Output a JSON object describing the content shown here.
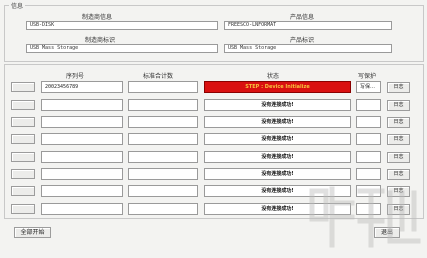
{
  "info": {
    "group_title": "信息",
    "manufacturer_info_label": "制造商信息",
    "product_info_label": "产品信息",
    "manufacturer_id_label": "制造商标识",
    "product_id_label": "产品标识",
    "manufacturer_info_value": "USB-DISK",
    "product_info_value": "FREESCO-LNFORMAT",
    "manufacturer_id_value": "USB Mass Storage",
    "product_id_value": "USB Mass Storage"
  },
  "table": {
    "headers": {
      "serial": "序列号",
      "counter": "标准合计数",
      "status": "状态",
      "protect": "写保护"
    },
    "log_label": "日志",
    "rows": [
      {
        "serial": "20023456789",
        "counter": "",
        "status": "STEP : Device Initialize",
        "status_type": "error",
        "protect": "写保…"
      },
      {
        "serial": "",
        "counter": "",
        "status": "没有连接成功!",
        "status_type": "normal",
        "protect": ""
      },
      {
        "serial": "",
        "counter": "",
        "status": "没有连接成功!",
        "status_type": "normal",
        "protect": ""
      },
      {
        "serial": "",
        "counter": "",
        "status": "没有连接成功!",
        "status_type": "normal",
        "protect": ""
      },
      {
        "serial": "",
        "counter": "",
        "status": "没有连接成功!",
        "status_type": "normal",
        "protect": ""
      },
      {
        "serial": "",
        "counter": "",
        "status": "没有连接成功!",
        "status_type": "normal",
        "protect": ""
      },
      {
        "serial": "",
        "counter": "",
        "status": "没有连接成功!",
        "status_type": "normal",
        "protect": ""
      },
      {
        "serial": "",
        "counter": "",
        "status": "没有连接成功!",
        "status_type": "normal",
        "protect": ""
      }
    ]
  },
  "buttons": {
    "start_all": "全部开始",
    "exit": "退出"
  },
  "colors": {
    "error_bg": "#d91010",
    "error_text": "#f7c23c"
  }
}
